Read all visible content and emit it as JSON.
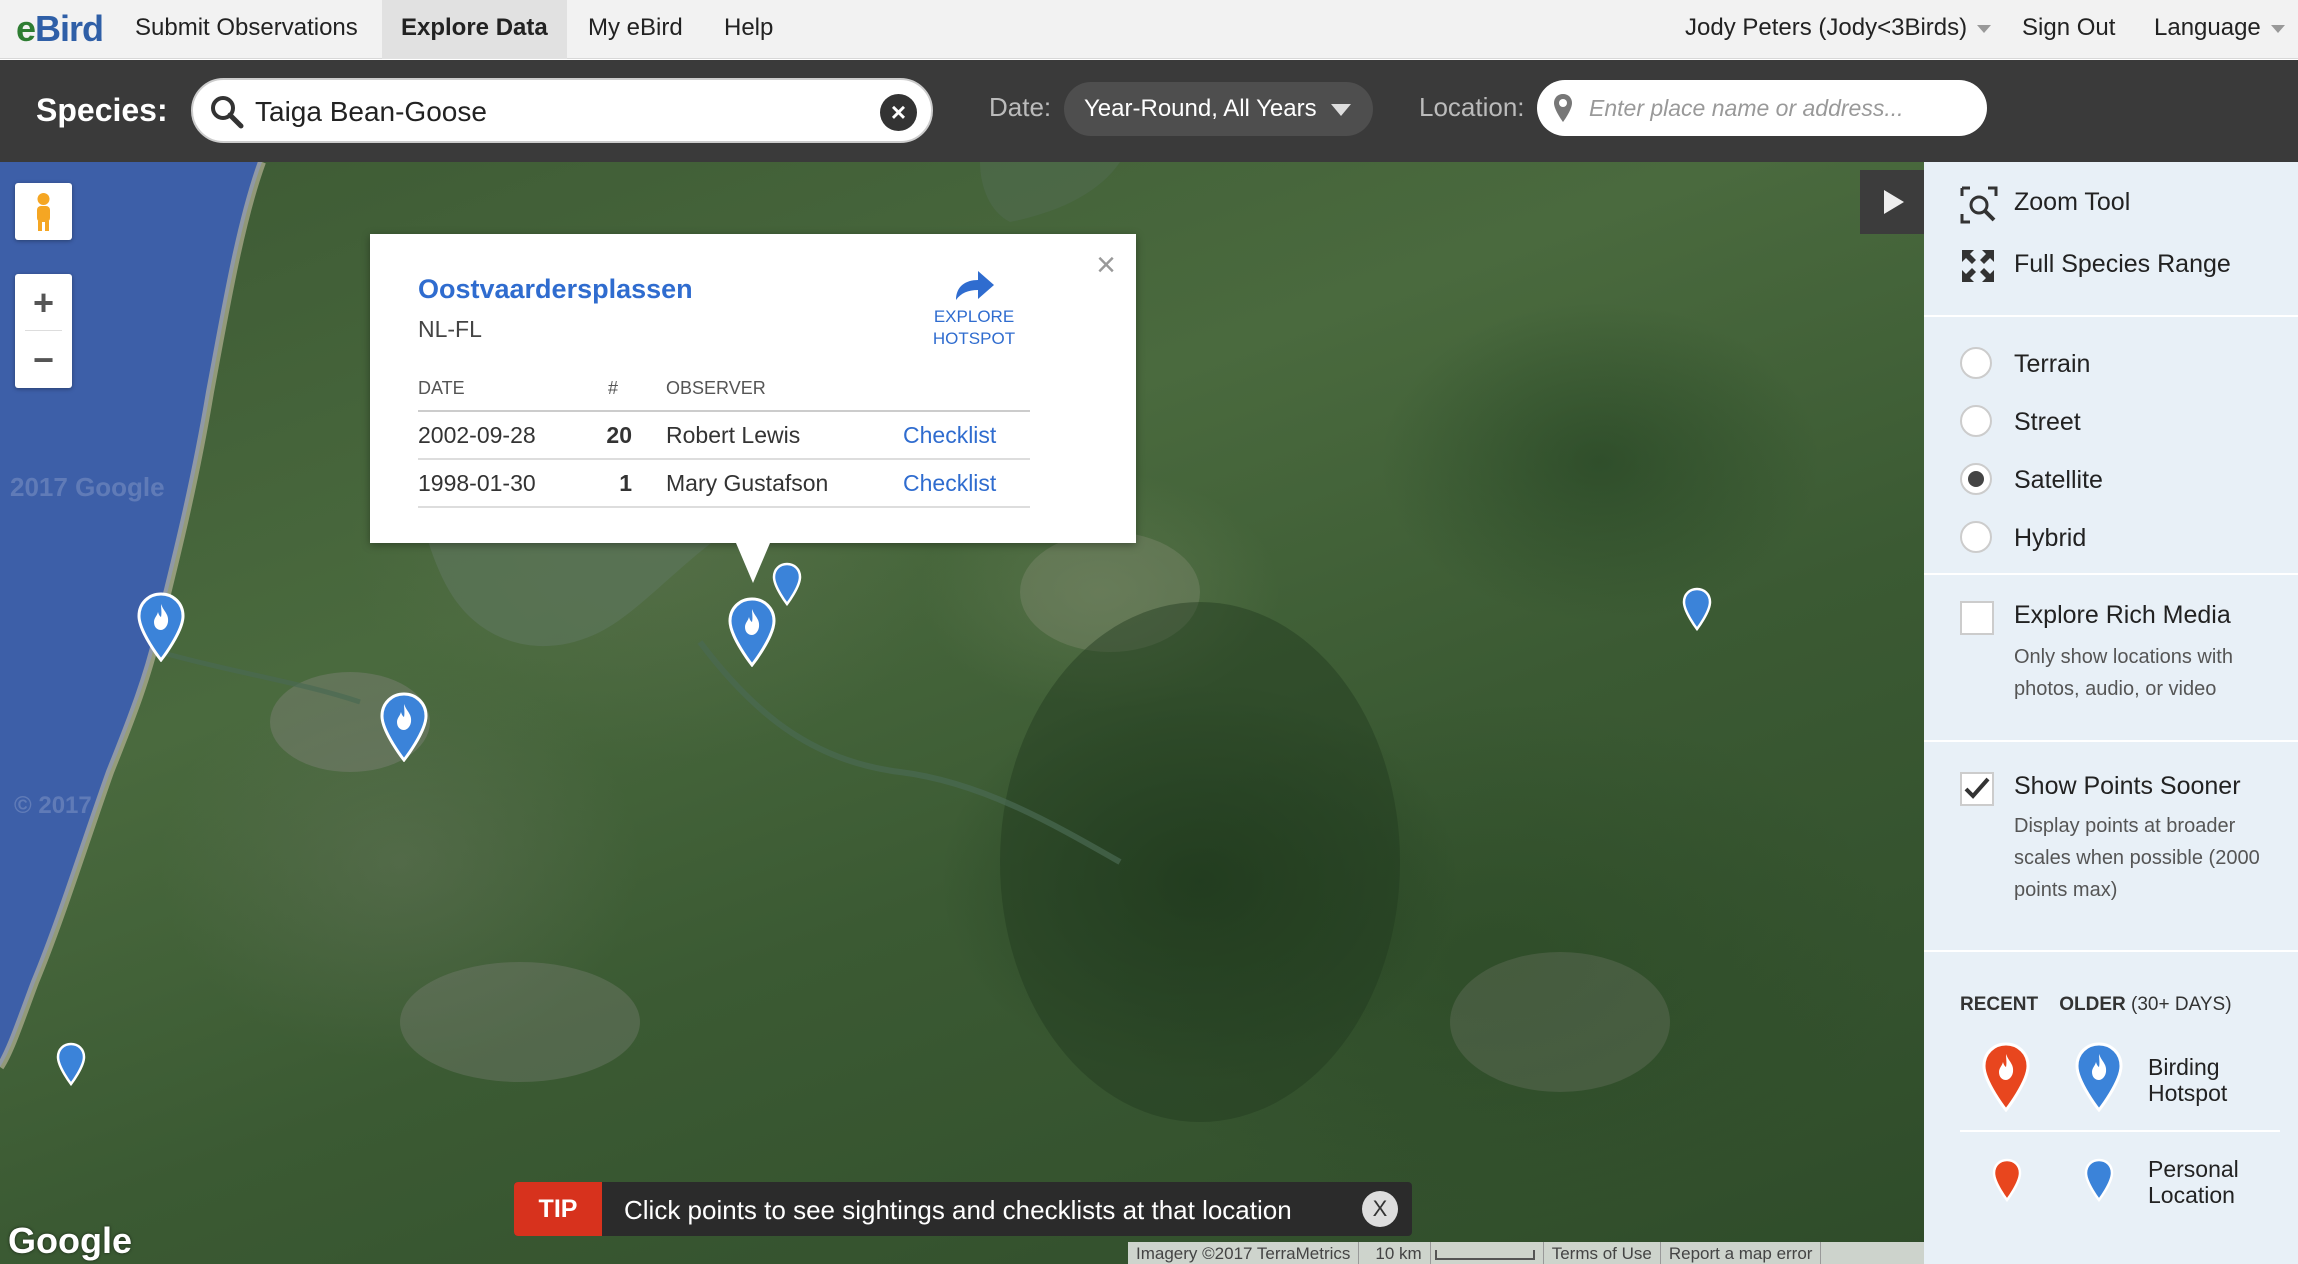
{
  "nav": {
    "logo_e": "e",
    "logo_bird": "Bird",
    "items": [
      {
        "label": "Submit Observations"
      },
      {
        "label": "Explore Data"
      },
      {
        "label": "My eBird"
      },
      {
        "label": "Help"
      }
    ],
    "user": "Jody Peters (Jody<3Birds)",
    "sign_out": "Sign Out",
    "language": "Language"
  },
  "search": {
    "species_label": "Species:",
    "species_value": "Taiga Bean-Goose",
    "date_label": "Date:",
    "date_value": "Year-Round, All Years",
    "location_label": "Location:",
    "location_placeholder": "Enter place name or address..."
  },
  "map": {
    "watermark_a": "2017 Google",
    "watermark_b": "© 2017",
    "google_logo": "Google",
    "footer": {
      "imagery": "Imagery ©2017 TerraMetrics",
      "scale": "10 km",
      "terms": "Terms of Use",
      "report": "Report a map error"
    }
  },
  "popup": {
    "title": "Oostvaardersplassen",
    "region": "NL-FL",
    "explore_line1": "EXPLORE",
    "explore_line2": "HOTSPOT",
    "columns": {
      "date": "DATE",
      "count": "#",
      "observer": "OBSERVER"
    },
    "rows": [
      {
        "date": "2002-09-28",
        "count": "20",
        "observer": "Robert Lewis",
        "link": "Checklist"
      },
      {
        "date": "1998-01-30",
        "count": "1",
        "observer": "Mary Gustafson",
        "link": "Checklist"
      }
    ]
  },
  "tip": {
    "badge": "TIP",
    "text": "Click points to see sightings and checklists at that location",
    "close": "X"
  },
  "panel": {
    "zoom_tool": "Zoom Tool",
    "full_range": "Full Species Range",
    "map_types": [
      {
        "label": "Terrain",
        "selected": false
      },
      {
        "label": "Street",
        "selected": false
      },
      {
        "label": "Satellite",
        "selected": true
      },
      {
        "label": "Hybrid",
        "selected": false
      }
    ],
    "rich_media": {
      "label": "Explore Rich Media",
      "checked": false,
      "desc": "Only show locations with photos, audio, or video"
    },
    "points_sooner": {
      "label": "Show Points Sooner",
      "checked": true,
      "desc": "Display points at broader scales when possible (2000 points max)"
    },
    "legend": {
      "recent": "RECENT",
      "older": "OLDER",
      "older_note": "(30+ DAYS)",
      "hotspot_1": "Birding",
      "hotspot_2": "Hotspot",
      "personal_1": "Personal",
      "personal_2": "Location"
    }
  },
  "colors": {
    "accent_blue": "#2f6ccf",
    "recent_pin": "#e8461e",
    "older_pin": "#3b83d9",
    "tip_red": "#d7321d"
  }
}
